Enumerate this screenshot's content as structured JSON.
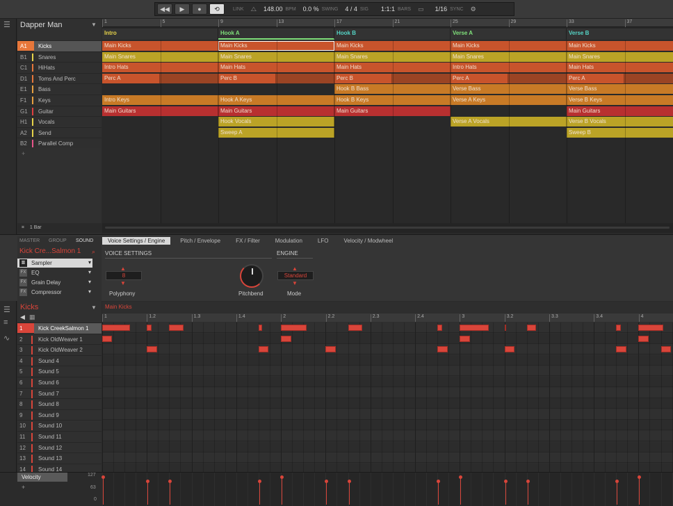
{
  "transport": {
    "link": "LINK",
    "tempo": "148.00",
    "tempo_unit": "BPM",
    "swing": "0.0 %",
    "swing_label": "SWING",
    "sig": "4 / 4",
    "sig_label": "SIG",
    "position": "1:1:1",
    "position_label": "BARS",
    "quant": "1/16",
    "sync_label": "SYNC"
  },
  "project": {
    "title": "Dapper Man"
  },
  "ruler": [
    "1",
    "5",
    "9",
    "13",
    "17",
    "21",
    "25",
    "29",
    "33",
    "37"
  ],
  "scenes": [
    {
      "label": "Intro",
      "color": "#e8d44a"
    },
    {
      "label": "Hook A",
      "color": "#7fe07a"
    },
    {
      "label": "Hook B",
      "color": "#55d4c6"
    },
    {
      "label": "Verse A",
      "color": "#7fe07a"
    },
    {
      "label": "Verse B",
      "color": "#55d4c6"
    }
  ],
  "groups": [
    {
      "id": "A1",
      "name": "Kicks",
      "color": "#e8773a",
      "selected": true
    },
    {
      "id": "B1",
      "name": "Snares",
      "color": "#e8d44a"
    },
    {
      "id": "C1",
      "name": "HiHats",
      "color": "#e8773a"
    },
    {
      "id": "D1",
      "name": "Toms And Perc",
      "color": "#e8773a"
    },
    {
      "id": "E1",
      "name": "Bass",
      "color": "#e8a040"
    },
    {
      "id": "F1",
      "name": "Keys",
      "color": "#e8a040"
    },
    {
      "id": "G1",
      "name": "Guitar",
      "color": "#e04040"
    },
    {
      "id": "H1",
      "name": "Vocals",
      "color": "#e8d44a"
    },
    {
      "id": "A2",
      "name": "Send",
      "color": "#e8d44a"
    },
    {
      "id": "B2",
      "name": "Parallel Comp",
      "color": "#e8558a"
    }
  ],
  "add_label": "+",
  "clips": [
    [
      {
        "t": "Main Kicks",
        "c": "#c8542c"
      },
      {
        "t": "Main Kicks",
        "c": "#c8542c"
      },
      {
        "t": "Main Kicks",
        "c": "#c8542c"
      },
      {
        "t": "Main Kicks",
        "c": "#c8542c"
      },
      {
        "t": "Main Kicks",
        "c": "#c8542c"
      }
    ],
    [
      {
        "t": "Main Snares",
        "c": "#bba326"
      },
      {
        "t": "Main Snares",
        "c": "#bba326"
      },
      {
        "t": "Main Snares",
        "c": "#bba326"
      },
      {
        "t": "Main Snares",
        "c": "#bba326"
      },
      {
        "t": "Main Snares",
        "c": "#bba326"
      }
    ],
    [
      {
        "t": "Intro Hats",
        "c": "#c8542c"
      },
      {
        "t": "Main Hats",
        "c": "#c8542c"
      },
      {
        "t": "Main Hats",
        "c": "#c8542c"
      },
      {
        "t": "Intro Hats",
        "c": "#c8542c"
      },
      {
        "t": "Main Hats",
        "c": "#c8542c"
      }
    ],
    [
      {
        "t": "Perc A",
        "c": "#c8542c",
        "half": true
      },
      {
        "t": "Perc B",
        "c": "#c8542c",
        "half": true
      },
      {
        "t": "Perc B",
        "c": "#c8542c",
        "half": true
      },
      {
        "t": "Perc A",
        "c": "#c8542c",
        "half": true
      },
      {
        "t": "Perc A",
        "c": "#c8542c",
        "half": true
      }
    ],
    [
      null,
      null,
      {
        "t": "Hook B Bass",
        "c": "#c87a26"
      },
      {
        "t": "Verse Bass",
        "c": "#c87a26"
      },
      {
        "t": "Verse Bass",
        "c": "#c87a26"
      }
    ],
    [
      {
        "t": "Intro Keys",
        "c": "#c87a26"
      },
      {
        "t": "Hook A Keys",
        "c": "#c87a26"
      },
      {
        "t": "Hook B Keys",
        "c": "#c87a26"
      },
      {
        "t": "Verse A Keys",
        "c": "#c87a26"
      },
      {
        "t": "Verse B Keys",
        "c": "#c87a26"
      }
    ],
    [
      {
        "t": "Main Guitars",
        "c": "#b83030"
      },
      {
        "t": "Main Guitars",
        "c": "#b83030"
      },
      {
        "t": "Main Guitars",
        "c": "#b83030"
      },
      null,
      {
        "t": "Main Guitars",
        "c": "#b83030"
      }
    ],
    [
      null,
      {
        "t": "Hook Vocals",
        "c": "#bba326"
      },
      null,
      {
        "t": "Verse A Vocals",
        "c": "#bba326"
      },
      {
        "t": "Verse B Vocals",
        "c": "#bba326"
      }
    ],
    [
      null,
      {
        "t": "Sweep A",
        "c": "#bba326"
      },
      null,
      null,
      {
        "t": "Sweep B",
        "c": "#bba326"
      }
    ]
  ],
  "bar_label": "1 Bar",
  "mid": {
    "tabs_left": [
      "MASTER",
      "GROUP",
      "SOUND"
    ],
    "sound_name": "Kick Cre...Salmon 1",
    "plugins": [
      {
        "badge": "",
        "name": "Sampler"
      },
      {
        "badge": "FX",
        "name": "EQ"
      },
      {
        "badge": "FX",
        "name": "Grain Delay"
      },
      {
        "badge": "FX",
        "name": "Compressor"
      }
    ],
    "tabs": [
      "Voice Settings / Engine",
      "Pitch / Envelope",
      "FX / Filter",
      "Modulation",
      "LFO",
      "Velocity / Modwheel"
    ],
    "voice_label": "VOICE SETTINGS",
    "engine_label": "ENGINE",
    "polyphony_value": "8",
    "polyphony_label": "Polyphony",
    "pitchbend_label": "Pitchbend",
    "mode_value": "Standard",
    "mode_label": "Mode"
  },
  "pattern": {
    "group_name": "Kicks",
    "pattern_name": "Main Kicks",
    "ruler": [
      "1",
      "1.2",
      "1.3",
      "1.4",
      "2",
      "2.2",
      "2.3",
      "2.4",
      "3",
      "3.2",
      "3.3",
      "3.4",
      "4"
    ],
    "sounds": [
      {
        "n": "1",
        "name": "Kick CreekSalmon 1"
      },
      {
        "n": "2",
        "name": "Kick OldWeaver 1"
      },
      {
        "n": "3",
        "name": "Kick OldWeaver 2"
      },
      {
        "n": "4",
        "name": "Sound 4"
      },
      {
        "n": "5",
        "name": "Sound 5"
      },
      {
        "n": "6",
        "name": "Sound 6"
      },
      {
        "n": "7",
        "name": "Sound 7"
      },
      {
        "n": "8",
        "name": "Sound 8"
      },
      {
        "n": "9",
        "name": "Sound 9"
      },
      {
        "n": "10",
        "name": "Sound 10"
      },
      {
        "n": "11",
        "name": "Sound 11"
      },
      {
        "n": "12",
        "name": "Sound 12"
      },
      {
        "n": "13",
        "name": "Sound 13"
      },
      {
        "n": "14",
        "name": "Sound 14"
      }
    ]
  },
  "velocity": {
    "label": "Velocity",
    "max": "127",
    "mid": "63",
    "min": "0"
  }
}
